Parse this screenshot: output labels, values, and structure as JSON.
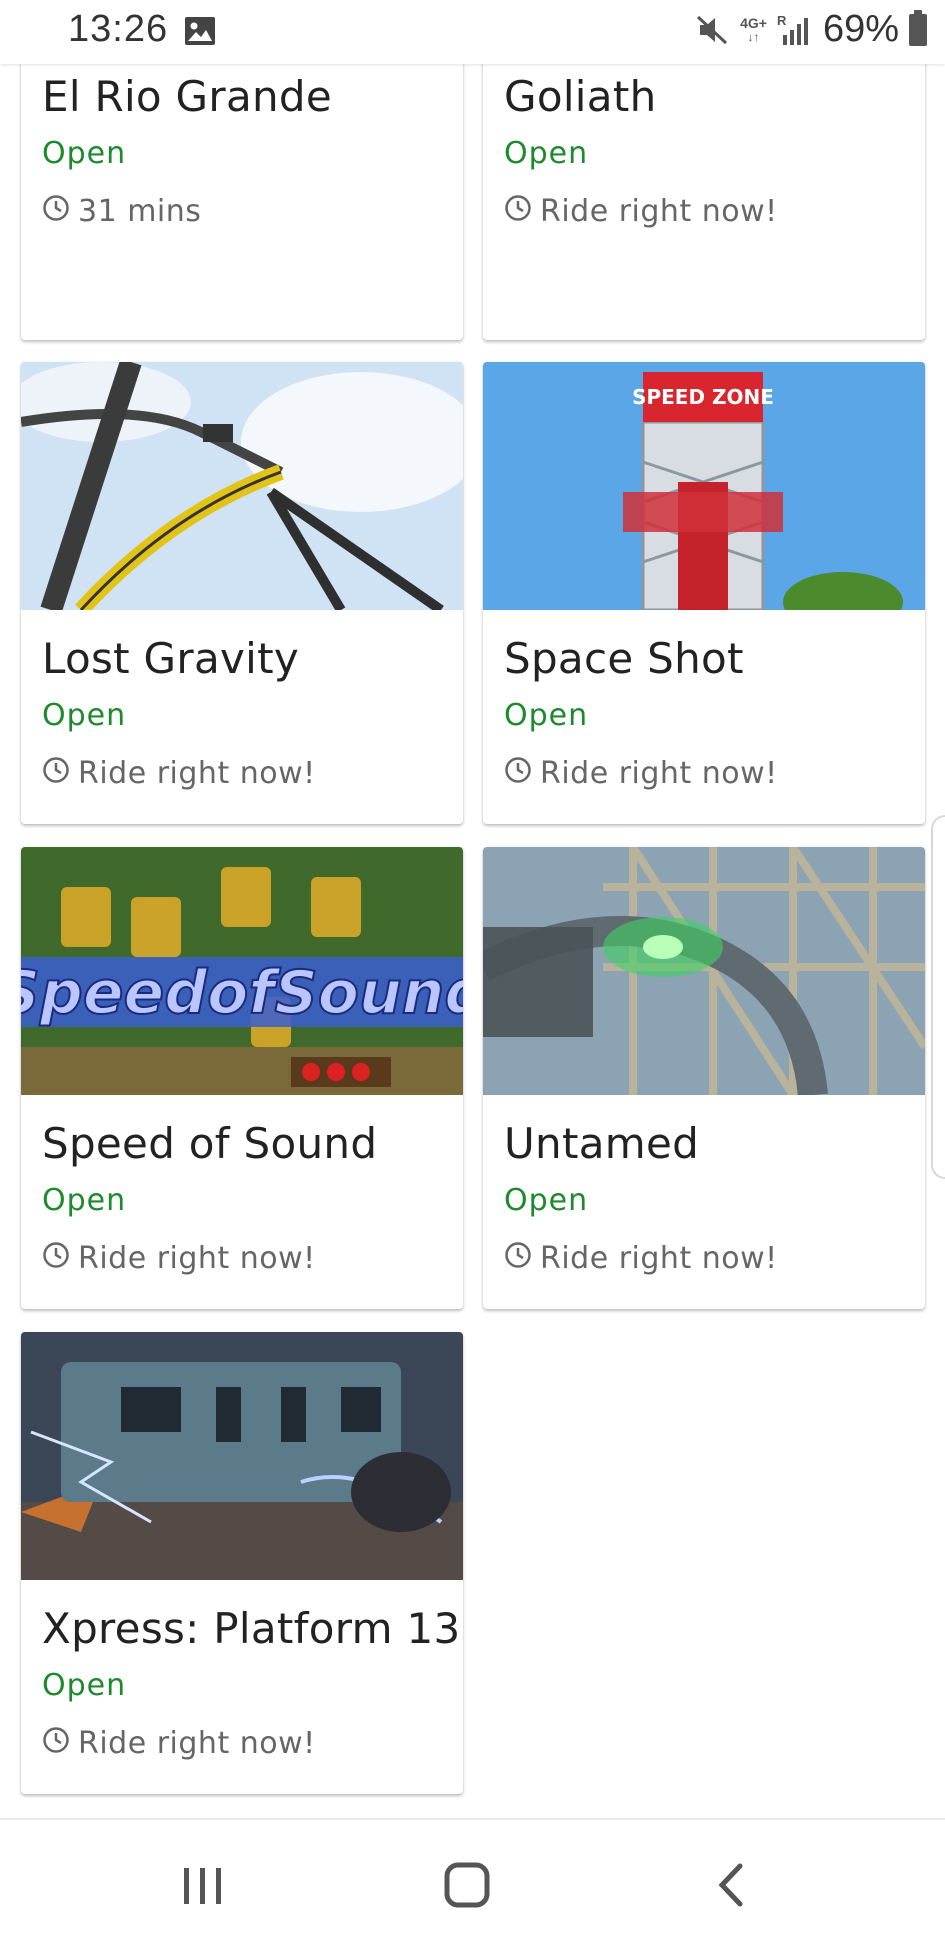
{
  "status_bar": {
    "time": "13:26",
    "network": "4G+",
    "roaming": "R",
    "battery": "69%",
    "icons": [
      "image-icon",
      "mute-icon",
      "signal-icon",
      "battery-icon"
    ]
  },
  "rides": [
    {
      "name": "El Rio Grande",
      "status": "Open",
      "wait": "31 mins"
    },
    {
      "name": "Goliath",
      "status": "Open",
      "wait": "Ride right now!"
    },
    {
      "name": "Lost Gravity",
      "status": "Open",
      "wait": "Ride right now!"
    },
    {
      "name": "Space Shot",
      "status": "Open",
      "wait": "Ride right now!"
    },
    {
      "name": "Speed of Sound",
      "status": "Open",
      "wait": "Ride right now!"
    },
    {
      "name": "Untamed",
      "status": "Open",
      "wait": "Ride right now!"
    },
    {
      "name": "Xpress: Platform 13",
      "status": "Open",
      "wait": "Ride right now!"
    }
  ],
  "image_text": {
    "space_shot_sign": "SPEED ZONE",
    "speed_of_sound_logo": "SpeedofSound"
  },
  "colors": {
    "open_status": "#1e8a2e",
    "wait_text": "#666666",
    "title_text": "#222222"
  },
  "nav": {
    "icons": [
      "recent-apps-icon",
      "home-icon",
      "back-icon"
    ]
  }
}
